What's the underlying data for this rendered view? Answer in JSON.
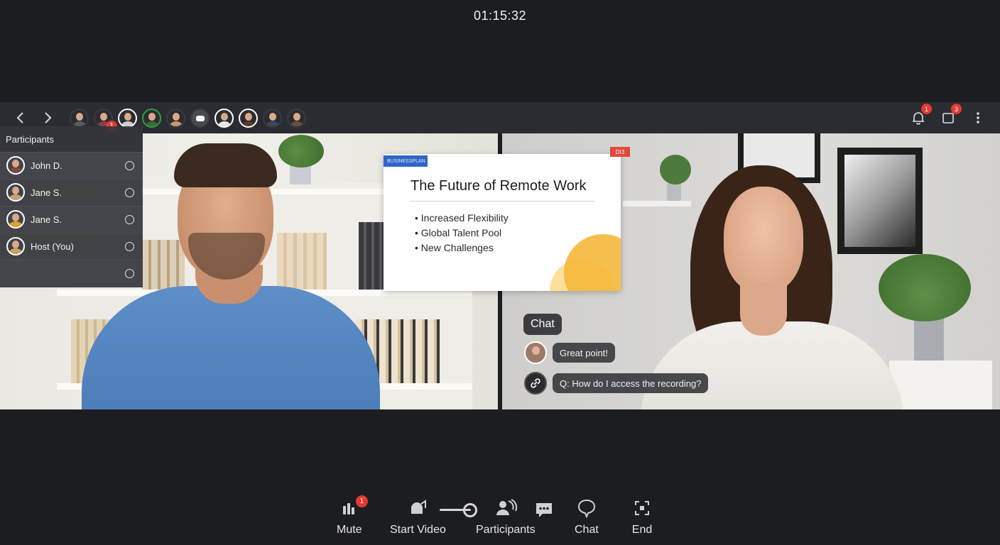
{
  "call": {
    "timer": "01:15:32"
  },
  "topbar": {
    "participant_avatars": [
      {
        "name": "avatar-1",
        "shirt": "#5c5c60",
        "ring": "default",
        "badge": ""
      },
      {
        "name": "avatar-2",
        "shirt": "#8a3f3f",
        "ring": "default",
        "badge": "1"
      },
      {
        "name": "avatar-3",
        "shirt": "#cfcfcf",
        "ring": "white",
        "badge": ""
      },
      {
        "name": "avatar-4",
        "shirt": "#3d6b3a",
        "ring": "green",
        "badge": ""
      },
      {
        "name": "avatar-5",
        "shirt": "#c79a62",
        "ring": "default",
        "badge": ""
      },
      {
        "name": "avatar-bot",
        "shirt": "#4a4b50",
        "ring": "default",
        "badge": "",
        "robot": true
      },
      {
        "name": "avatar-7",
        "shirt": "#e8e8e8",
        "ring": "white",
        "badge": ""
      },
      {
        "name": "avatar-8",
        "shirt": "#5a3a30",
        "ring": "white",
        "badge": ""
      },
      {
        "name": "avatar-9",
        "shirt": "#3a4a5a",
        "ring": "default",
        "badge": ""
      },
      {
        "name": "avatar-10",
        "shirt": "#6a5040",
        "ring": "default",
        "badge": ""
      }
    ],
    "notifications_badge": "1",
    "screens_badge": "3"
  },
  "participants_panel": {
    "title": "Participants",
    "rows": [
      {
        "name": "John D.",
        "shirt": "#7a4a3a"
      },
      {
        "name": "Jane S.",
        "shirt": "#c9a07a"
      },
      {
        "name": "Jane S.",
        "shirt": "#e0a030"
      },
      {
        "name": "Host (You)",
        "shirt": "#c7a25a"
      },
      {
        "name": "",
        "shirt": ""
      }
    ]
  },
  "slide": {
    "tag": "BUSINESSPLAN",
    "corner_tag": "DI3",
    "title": "The Future of Remote Work",
    "bullets": [
      "Increased Flexibility",
      "Global Talent Pool",
      "New Challenges"
    ]
  },
  "chat": {
    "title": "Chat",
    "messages": [
      {
        "text": "Great point!",
        "avatar": "photo"
      },
      {
        "text": "Q: How do I access the recording?",
        "avatar": "logo"
      }
    ]
  },
  "toolbar": {
    "mute_label": "Mute",
    "mute_badge": "1",
    "start_video_label": "Start Video",
    "participants_label": "Participants",
    "chat_label": "Chat",
    "end_label": "End",
    "volume_level": 0.75
  },
  "colors": {
    "background": "#1c1d21",
    "strip": "#2b2c31",
    "badge": "#e53935",
    "accent_blue": "#2f67c7"
  }
}
